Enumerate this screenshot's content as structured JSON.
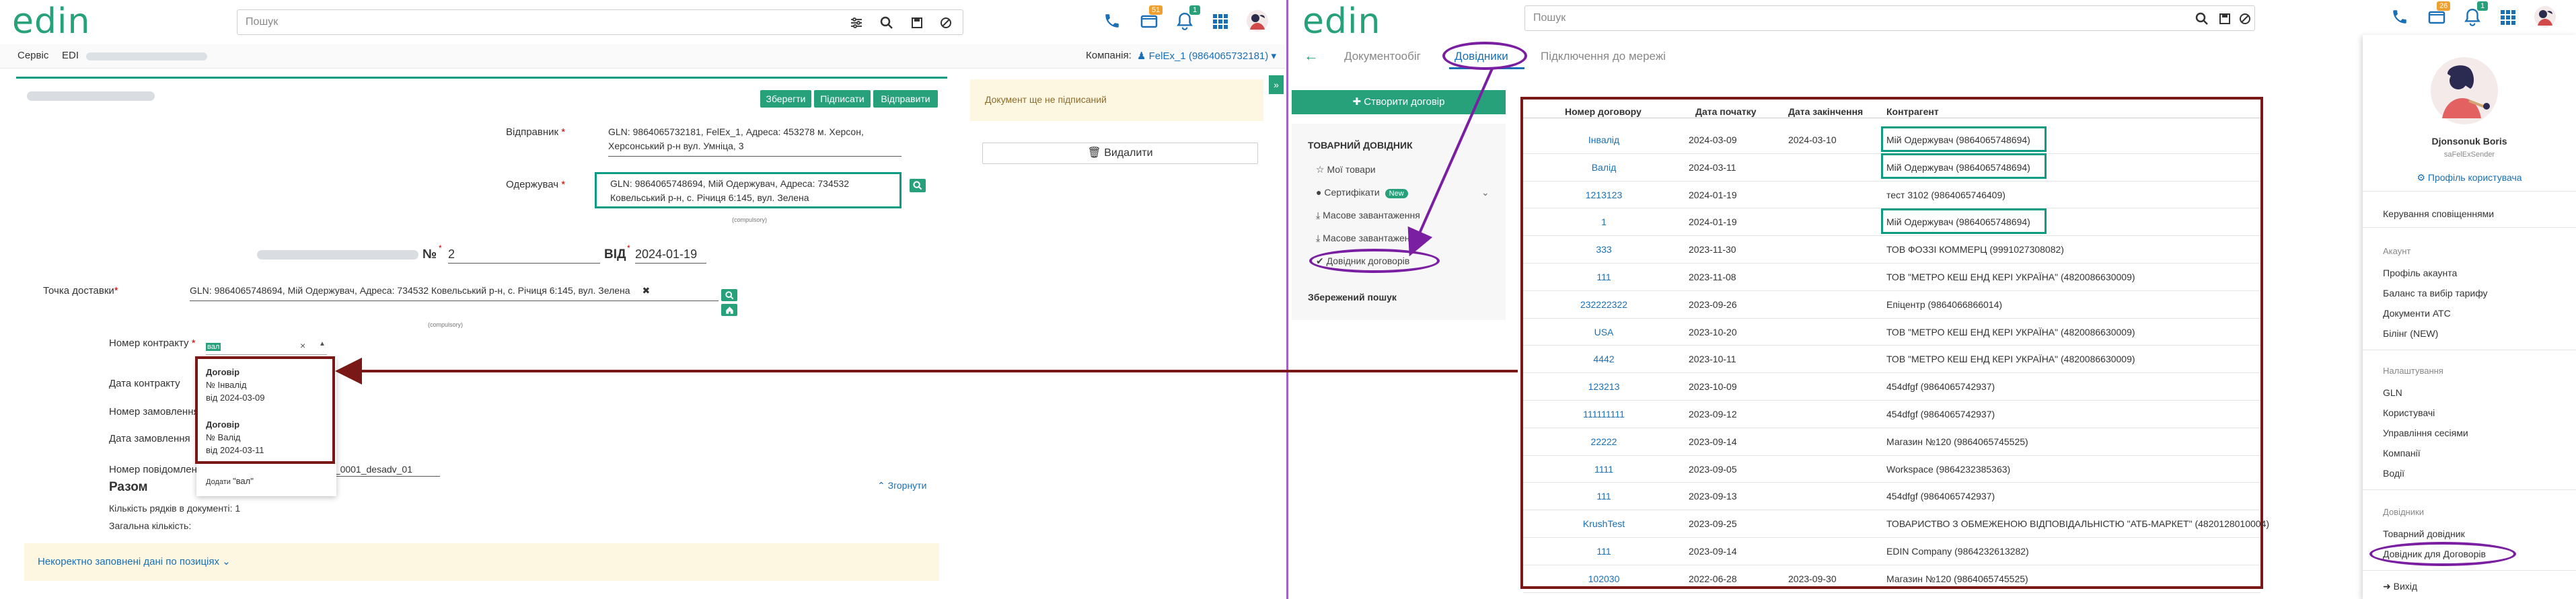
{
  "colors": {
    "brand_green": "#26a17a",
    "teal": "#0d9b84",
    "link_blue": "#1a6fb5",
    "dark_red": "#7a1717",
    "purple": "#7b1fa2",
    "notice_bg": "#fdf6e0",
    "sidebar_bg": "#f7f7f7"
  },
  "left": {
    "logo": "edin",
    "search_placeholder": "Пошук",
    "badges": {
      "docs": "51",
      "bell": "1"
    },
    "breadcrumb": [
      "Сервіс",
      "EDI"
    ],
    "company_label": "Компанія:",
    "company_value": "FelEx_1 (9864065732181)",
    "buttons": {
      "save": "Зберегти",
      "sign": "Підписати",
      "send": "Відправити"
    },
    "sender_label": "Відправник",
    "sender_value_1": "GLN: 9864065732181, FelEx_1, Адреса: 453278 м. Херсон,",
    "sender_value_2": "Херсонський р-н вул. Умніца, 3",
    "receiver_label": "Одержувач",
    "receiver_value_1": "GLN: 9864065748694, Мій Одержувач, Адреса: 734532",
    "receiver_value_2": "Ковельський р-н, с. Річиця 6:145, вул. Зелена",
    "receiver_hint": "(compulsory)",
    "doc_no_symbol": "№",
    "doc_no_value": "2",
    "date_label": "ВІД",
    "date_value": "2024-01-19",
    "delivery_label": "Точка доставки",
    "delivery_value": "GLN: 9864065748694, Мій Одержувач, Адреса: 734532 Ковельський р-н, с. Річиця 6:145, вул. Зелена",
    "delivery_hint": "(compulsory)",
    "contract_label": "Номер контракту",
    "contract_value": "вал",
    "contract_date_label": "Дата контракту",
    "order_no_label": "Номер замовлення",
    "order_date_label": "Дата замовлення",
    "notice_no_label": "Номер повідомлення",
    "notice_no_value": "0_0001_desadv_01",
    "dropdown": [
      {
        "title": "Договір",
        "number": "№ Інвалід",
        "date": "від 2024-03-09"
      },
      {
        "title": "Договір",
        "number": "№ Валід",
        "date": "від 2024-03-11"
      }
    ],
    "add_label": "Додати",
    "add_value": "\"вал\"",
    "section_title": "Разом",
    "rows_label": "Кількість рядків в документі: 1",
    "total_label": "Загальна кількість:",
    "collapse_label": "Згорнути",
    "warning": "Некоректно заповнені дані по позиціях",
    "status_notice": "Документ ще не підписаний",
    "delete_label": "Видалити"
  },
  "right": {
    "logo": "edin",
    "search_placeholder": "Пошук",
    "badges": {
      "docs": "26",
      "bell": "1"
    },
    "tabs": [
      "Документообіг",
      "Довідники",
      "Підключення до мережі"
    ],
    "create_button": "Створити договір",
    "nav_section": "ТОВАРНИЙ ДОВІДНИК",
    "nav_items": [
      "Мої товари",
      "Сертифікати",
      "Масове завантаження",
      "Масове завантаження",
      "Довідник договорів"
    ],
    "new_badge": "New",
    "saved_search": "Збережений пошук",
    "table": {
      "headers": [
        "Номер договору",
        "Дата початку",
        "Дата закінчення",
        "Контрагент"
      ],
      "rows": [
        [
          "Інвалід",
          "2024-03-09",
          "2024-03-10",
          "Мій Одержувач (9864065748694)"
        ],
        [
          "Валід",
          "2024-03-11",
          "",
          "Мій Одержувач (9864065748694)"
        ],
        [
          "1213123",
          "2024-01-19",
          "",
          "тест 3102 (9864065746409)"
        ],
        [
          "1",
          "2024-01-19",
          "",
          "Мій Одержувач (9864065748694)"
        ],
        [
          "333",
          "2023-11-30",
          "",
          "ТОВ ФОЗЗІ КОММЕРЦ (9991027308082)"
        ],
        [
          "111",
          "2023-11-08",
          "",
          "ТОВ \"МЕТРО КЕШ ЕНД КЕРІ УКРАЇНА\" (4820086630009)"
        ],
        [
          "232222322",
          "2023-09-26",
          "",
          "Епіцентр (9864066866014)"
        ],
        [
          "USA",
          "2023-10-20",
          "",
          "ТОВ \"МЕТРО КЕШ ЕНД КЕРІ УКРАЇНА\" (4820086630009)"
        ],
        [
          "4442",
          "2023-10-11",
          "",
          "ТОВ \"МЕТРО КЕШ ЕНД КЕРІ УКРАЇНА\" (4820086630009)"
        ],
        [
          "123213",
          "2023-10-09",
          "",
          "454dfgf (9864065742937)"
        ],
        [
          "111111111",
          "2023-09-12",
          "",
          "454dfgf (9864065742937)"
        ],
        [
          "22222",
          "2023-09-14",
          "",
          "Магазин №120 (9864065745525)"
        ],
        [
          "1111",
          "2023-09-05",
          "",
          "Workspace (9864232385363)"
        ],
        [
          "111",
          "2023-09-13",
          "",
          "454dfgf (9864065742937)"
        ],
        [
          "KrushTest",
          "2023-09-25",
          "",
          "ТОВАРИСТВО З ОБМЕЖЕНОЮ ВІДПОВІДАЛЬНІСТЮ \"АТБ-МАРКЕТ\" (4820128010004)"
        ],
        [
          "111",
          "2023-09-14",
          "",
          "EDIN Company (9864232613282)"
        ],
        [
          "102030",
          "2022-06-28",
          "2023-09-30",
          "Магазин №120 (9864065745525)"
        ]
      ]
    },
    "profile": {
      "name": "Djonsonuk Boris",
      "role": "saFelExSender",
      "profile_link": "Профіль користувача",
      "notifications": "Керування сповіщеннями",
      "account_section": "Акаунт",
      "account_items": [
        "Профіль акаунта",
        "Баланс та вибір тарифу",
        "Документи АТС",
        "Білінг (NEW)"
      ],
      "settings_section": "Налаштування",
      "settings_items": [
        "GLN",
        "Користувачі",
        "Управління сесіями",
        "Компанії",
        "Водії"
      ],
      "dirs_section": "Довідники",
      "dirs_items": [
        "Товарний довідник",
        "Довідник для Договорів"
      ],
      "logout": "Вихід"
    }
  }
}
